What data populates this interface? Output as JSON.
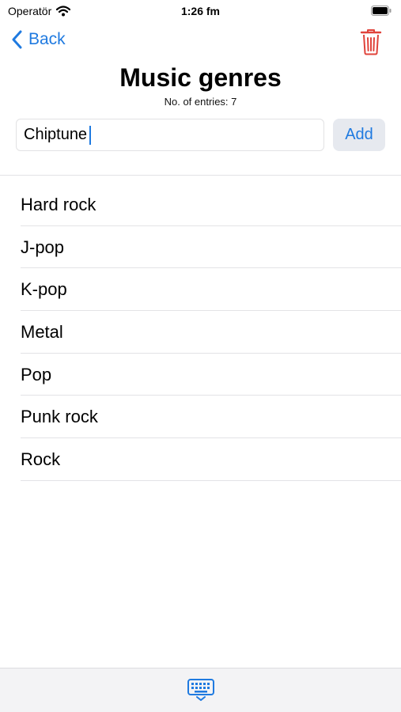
{
  "status_bar": {
    "carrier": "Operatör",
    "time": "1:26 fm"
  },
  "nav": {
    "back_label": "Back"
  },
  "header": {
    "title": "Music genres",
    "entries_text": "No. of entries: 7"
  },
  "input": {
    "value": "Chiptune",
    "add_label": "Add"
  },
  "genres": [
    "Hard rock",
    "J-pop",
    "K-pop",
    "Metal",
    "Pop",
    "Punk rock",
    "Rock"
  ],
  "icons": {
    "back": "chevron-left-icon",
    "trash": "trash-icon",
    "keyboard": "keyboard-dismiss-icon",
    "wifi": "wifi-icon",
    "battery": "battery-icon"
  },
  "colors": {
    "accent": "#1f7ae0",
    "destructive": "#e0433b"
  }
}
